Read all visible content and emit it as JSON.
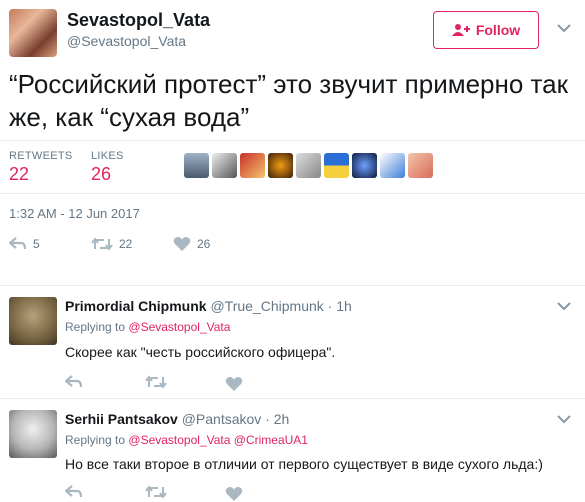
{
  "tweet": {
    "author_name": "Sevastopol_Vata",
    "author_handle": "@Sevastopol_Vata",
    "follow_label": "Follow",
    "text": "“Российский протест” это звучит примерно так же, как “сухая вода”",
    "retweets_label": "RETWEETS",
    "retweets_count": "22",
    "likes_label": "LIKES",
    "likes_count": "26",
    "timestamp": "1:32 AM - 12 Jun 2017",
    "actions": {
      "reply_count": "5",
      "retweet_count": "22",
      "like_count": "26"
    },
    "accent_color": "#e0245e"
  },
  "replies": [
    {
      "name": "Primordial Chipmunk",
      "handle": "@True_Chipmunk",
      "sep": "·",
      "time": "1h",
      "replying_label": "Replying to",
      "replying_to": "@Sevastopol_Vata",
      "replying_to_2": "",
      "text": "Скорее как \"честь российского офицера\"."
    },
    {
      "name": "Serhii Pantsakov",
      "handle": "@Pantsakov",
      "sep": "·",
      "time": "2h",
      "replying_label": "Replying to",
      "replying_to": "@Sevastopol_Vata",
      "replying_to_2": "@CrimeaUA1",
      "text": "Но все таки второе в отличии от первого существует в виде сухого льда:)"
    }
  ]
}
